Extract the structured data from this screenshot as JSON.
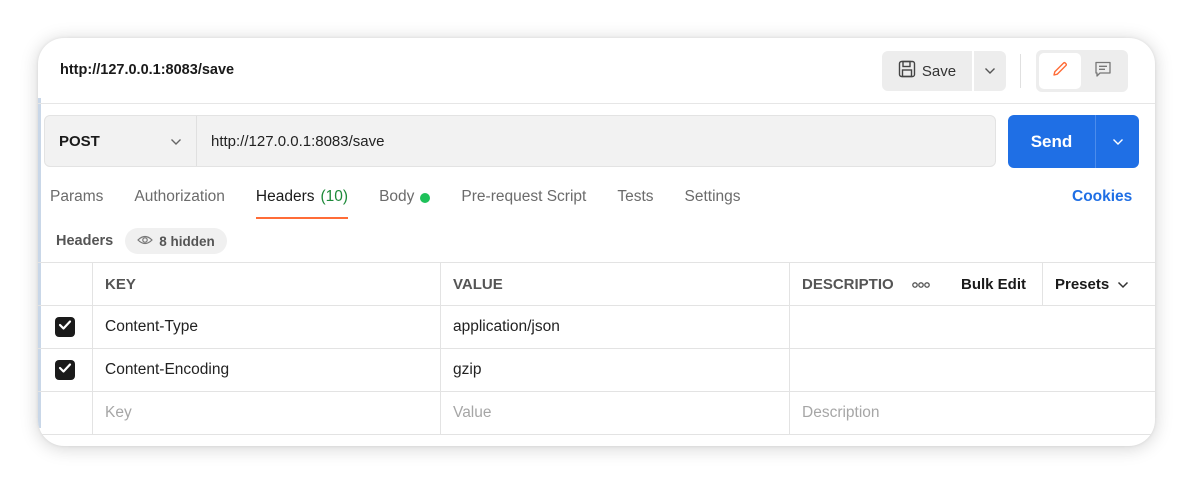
{
  "window": {
    "title": "http://127.0.0.1:8083/save",
    "save_label": "Save"
  },
  "request": {
    "method": "POST",
    "url": "http://127.0.0.1:8083/save",
    "send_label": "Send"
  },
  "tabs": [
    {
      "label": "Params"
    },
    {
      "label": "Authorization"
    },
    {
      "label": "Headers",
      "count": "(10)",
      "active": true
    },
    {
      "label": "Body",
      "has_content": true
    },
    {
      "label": "Pre-request Script"
    },
    {
      "label": "Tests"
    },
    {
      "label": "Settings"
    }
  ],
  "cookies_label": "Cookies",
  "headers_section": {
    "label": "Headers",
    "hidden_label": "8 hidden"
  },
  "table": {
    "columns": {
      "key": "KEY",
      "value": "VALUE",
      "description": "DESCRIPTIO",
      "bulk_edit": "Bulk Edit",
      "presets": "Presets"
    },
    "rows": [
      {
        "checked": true,
        "key": "Content-Type",
        "value": "application/json",
        "description": ""
      },
      {
        "checked": true,
        "key": "Content-Encoding",
        "value": "gzip",
        "description": ""
      }
    ],
    "placeholders": {
      "key": "Key",
      "value": "Value",
      "description": "Description"
    }
  },
  "colors": {
    "accent": "#ff6c37",
    "send": "#1f6fe5",
    "body_dot": "#1ec15a"
  }
}
